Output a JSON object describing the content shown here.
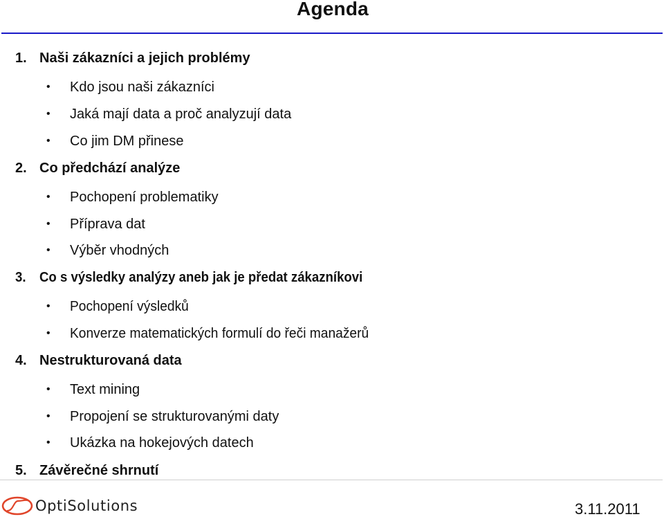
{
  "slide": {
    "title": "Agenda",
    "date": "3.11.2011",
    "logo_text": "OptiSolutions",
    "colors": {
      "title_rule": "#1a1ac8",
      "footer_rule": "#cfcfcf",
      "logo_mark": "#e0452a"
    }
  },
  "agenda": [
    {
      "number": "1.",
      "title": "Naši zákazníci a jejich problémy",
      "items": [
        "Kdo jsou naši zákazníci",
        "Jaká mají data a proč analyzují data",
        "Co jim DM přinese"
      ]
    },
    {
      "number": "2.",
      "title": "Co předchází analýze",
      "items": [
        "Pochopení problematiky",
        "Příprava dat",
        "Výběr vhodných"
      ]
    },
    {
      "number": "3.",
      "title": "Co s výsledky analýzy aneb jak je předat zákazníkovi",
      "items": [
        "Pochopení výsledků",
        "Konverze matematických formulí do řeči manažerů"
      ]
    },
    {
      "number": "4.",
      "title": "Nestrukturovaná data",
      "items": [
        "Text mining",
        "Propojení se strukturovanými daty",
        "Ukázka na hokejových datech"
      ]
    },
    {
      "number": "5.",
      "title": "Závěrečné shrnutí",
      "items": []
    }
  ],
  "icons": {
    "bullet": "•",
    "logo_mark": "optisolutions-swoosh-logo"
  }
}
